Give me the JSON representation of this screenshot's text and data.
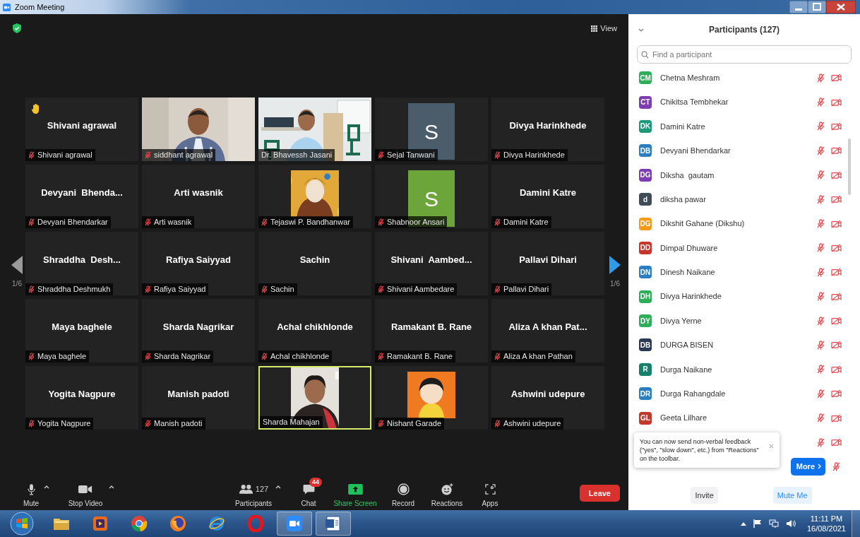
{
  "window": {
    "title": "Zoom Meeting"
  },
  "top_bar": {
    "view_button": "View"
  },
  "gallery": {
    "pager_left": "1/6",
    "pager_right": "1/6",
    "tiles": [
      {
        "kind": "name",
        "title": "Shivani agrawal",
        "label": "Shivani agrawal",
        "muted": true,
        "hand_raised": true,
        "active": false
      },
      {
        "kind": "video",
        "label": "siddhant agrawal",
        "muted": true,
        "hand_raised": false,
        "active": false
      },
      {
        "kind": "video",
        "label": "Dr. Bhavessh Jasani",
        "muted": false,
        "hand_raised": false,
        "active": false
      },
      {
        "kind": "avatar",
        "letter": "S",
        "color": "#4b5c6b",
        "label": "Sejal Tanwani",
        "muted": true,
        "hand_raised": false,
        "active": false
      },
      {
        "kind": "name",
        "title": "Divya Harinkhede",
        "label": "Divya Harinkhede",
        "muted": true,
        "hand_raised": false,
        "active": false
      },
      {
        "kind": "name",
        "title": "Devyani  Bhenda...",
        "label": "Devyani Bhendarkar",
        "muted": true,
        "hand_raised": false,
        "active": false
      },
      {
        "kind": "name",
        "title": "Arti wasnik",
        "label": "Arti wasnik",
        "muted": true,
        "hand_raised": false,
        "active": false
      },
      {
        "label": "Tejaswi P. Bandhanwar",
        "muted": true,
        "hand_raised": false,
        "active": false
      },
      {
        "kind": "avatar",
        "letter": "S",
        "color": "#6ca63a",
        "label": "Shabnoor Ansari",
        "muted": true,
        "hand_raised": false,
        "active": false
      },
      {
        "kind": "name",
        "title": "Damini Katre",
        "label": "Damini Katre",
        "muted": true,
        "hand_raised": false,
        "active": false
      },
      {
        "kind": "name",
        "title": "Shraddha  Desh...",
        "label": "Shraddha Deshmukh",
        "muted": true,
        "hand_raised": false,
        "active": false
      },
      {
        "kind": "name",
        "title": "Rafiya Saiyyad",
        "label": "Rafiya Saiyyad",
        "muted": true,
        "hand_raised": false,
        "active": false
      },
      {
        "kind": "name",
        "title": "Sachin",
        "label": "Sachin",
        "muted": true,
        "hand_raised": false,
        "active": false
      },
      {
        "kind": "name",
        "title": "Shivani  Aambed...",
        "label": "Shivani Aambedare",
        "muted": true,
        "hand_raised": false,
        "active": false
      },
      {
        "kind": "name",
        "title": "Pallavi Dihari",
        "label": "Pallavi Dihari",
        "muted": true,
        "hand_raised": false,
        "active": false
      },
      {
        "kind": "name",
        "title": "Maya baghele",
        "label": "Maya baghele",
        "muted": true,
        "hand_raised": false,
        "active": false
      },
      {
        "kind": "name",
        "title": "Sharda Nagrikar",
        "label": "Sharda Nagrikar",
        "muted": true,
        "hand_raised": false,
        "active": false
      },
      {
        "kind": "name",
        "title": "Achal chikhlonde",
        "label": "Achal chikhlonde",
        "muted": true,
        "hand_raised": false,
        "active": false
      },
      {
        "kind": "name",
        "title": "Ramakant B. Rane",
        "label": "Ramakant B. Rane",
        "muted": true,
        "hand_raised": false,
        "active": false
      },
      {
        "kind": "name",
        "title": "Aliza A khan Pat...",
        "label": "Aliza A khan Pathan",
        "muted": true,
        "hand_raised": false,
        "active": false
      },
      {
        "kind": "name",
        "title": "Yogita Nagpure",
        "label": "Yogita Nagpure",
        "muted": true,
        "hand_raised": false,
        "active": false
      },
      {
        "kind": "name",
        "title": "Manish padoti",
        "label": "Manish padoti",
        "muted": true,
        "hand_raised": false,
        "active": false
      },
      {
        "kind": "portrait",
        "label": "Sharda Mahajan",
        "muted": false,
        "hand_raised": false,
        "active": true
      },
      {
        "label": "Nishant Garade",
        "muted": true,
        "hand_raised": false,
        "active": false
      },
      {
        "kind": "name",
        "title": "Ashwini udepure",
        "label": "Ashwini udepure",
        "muted": true,
        "hand_raised": false,
        "active": false
      }
    ]
  },
  "toolbar": {
    "items": [
      {
        "kind": "mic",
        "label": "Mute",
        "caret": true
      },
      {
        "kind": "video",
        "label": "Stop Video",
        "caret": true
      },
      {
        "kind": "participants",
        "label": "Participants",
        "count": "127",
        "caret": true
      },
      {
        "kind": "chat",
        "label": "Chat",
        "badge": "44",
        "caret": false
      },
      {
        "kind": "share",
        "label": "Share Screen",
        "caret": false
      },
      {
        "kind": "record",
        "label": "Record",
        "caret": false
      },
      {
        "kind": "reactions",
        "label": "Reactions",
        "caret": false
      },
      {
        "kind": "apps",
        "label": "Apps",
        "caret": false
      }
    ],
    "leave": "Leave"
  },
  "participants_panel": {
    "title": "Participants (127)",
    "search": {
      "placeholder": "Find a participant"
    },
    "participants": [
      {
        "initials": "CM",
        "name": "Chetna Meshram",
        "color": "#2fae5a",
        "muted": true,
        "video_off": true
      },
      {
        "initials": "CT",
        "name": "Chikitsa Tembhekar",
        "color": "#7d3db0",
        "muted": true,
        "video_off": true
      },
      {
        "initials": "DK",
        "name": "Damini Katre",
        "color": "#1b9a7a",
        "muted": true,
        "video_off": true
      },
      {
        "initials": "DB",
        "name": "Devyani Bhendarkar",
        "color": "#2b7fc1",
        "muted": true,
        "video_off": true
      },
      {
        "initials": "DG",
        "name": "Diksha  gautam",
        "color": "#7d3db0",
        "muted": true,
        "video_off": true
      },
      {
        "initials": "d",
        "name": "diksha pawar",
        "color": "#3e4c59",
        "muted": true,
        "video_off": true
      },
      {
        "initials": "DG",
        "name": "Dikshit Gahane (Dikshu)",
        "color": "#f29b1d",
        "muted": true,
        "video_off": true
      },
      {
        "initials": "DD",
        "name": "Dimpal Dhuware",
        "color": "#c8352b",
        "muted": true,
        "video_off": true
      },
      {
        "initials": "DN",
        "name": "Dinesh Naikane",
        "color": "#2b7fc1",
        "muted": true,
        "video_off": true
      },
      {
        "initials": "DH",
        "name": "Divya Harinkhede",
        "color": "#2fae5a",
        "muted": true,
        "video_off": true
      },
      {
        "initials": "DY",
        "name": "Divya Yerne",
        "color": "#2fae5a",
        "muted": true,
        "video_off": true
      },
      {
        "initials": "DB",
        "name": "DURGA BISEN",
        "color": "#2a3a55",
        "muted": true,
        "video_off": true
      },
      {
        "initials": "R",
        "name": "Durga Naikane",
        "color": "#17806b",
        "muted": true,
        "video_off": true
      },
      {
        "initials": "DR",
        "name": "Durga Rahangdale",
        "color": "#2b7fc1",
        "muted": true,
        "video_off": true
      },
      {
        "initials": "GL",
        "name": "Geeta Lilhare",
        "color": "#c0392b",
        "muted": true,
        "video_off": true
      }
    ],
    "covered_row": {
      "muted": true,
      "video_off": true
    },
    "more_row": {
      "button": "More",
      "muted": true
    },
    "tooltip": "You can now send non-verbal feedback (\"yes\", \"slow down\", etc.) from \"Reactions\" on the toolbar.",
    "buttons": [
      {
        "kind": "plain",
        "label": "Invite"
      },
      {
        "kind": "primary",
        "label": "Mute Me"
      }
    ]
  },
  "taskbar": {
    "apps": [
      {
        "kind": "folder",
        "running": false
      },
      {
        "kind": "media",
        "running": false
      },
      {
        "kind": "chrome",
        "running": false
      },
      {
        "kind": "firefox",
        "running": false
      },
      {
        "kind": "ie",
        "running": false
      },
      {
        "kind": "opera",
        "running": false
      },
      {
        "kind": "zoom",
        "running": true
      },
      {
        "kind": "word",
        "running": true
      }
    ],
    "time": "11:11 PM",
    "date": "16/08/2021"
  }
}
